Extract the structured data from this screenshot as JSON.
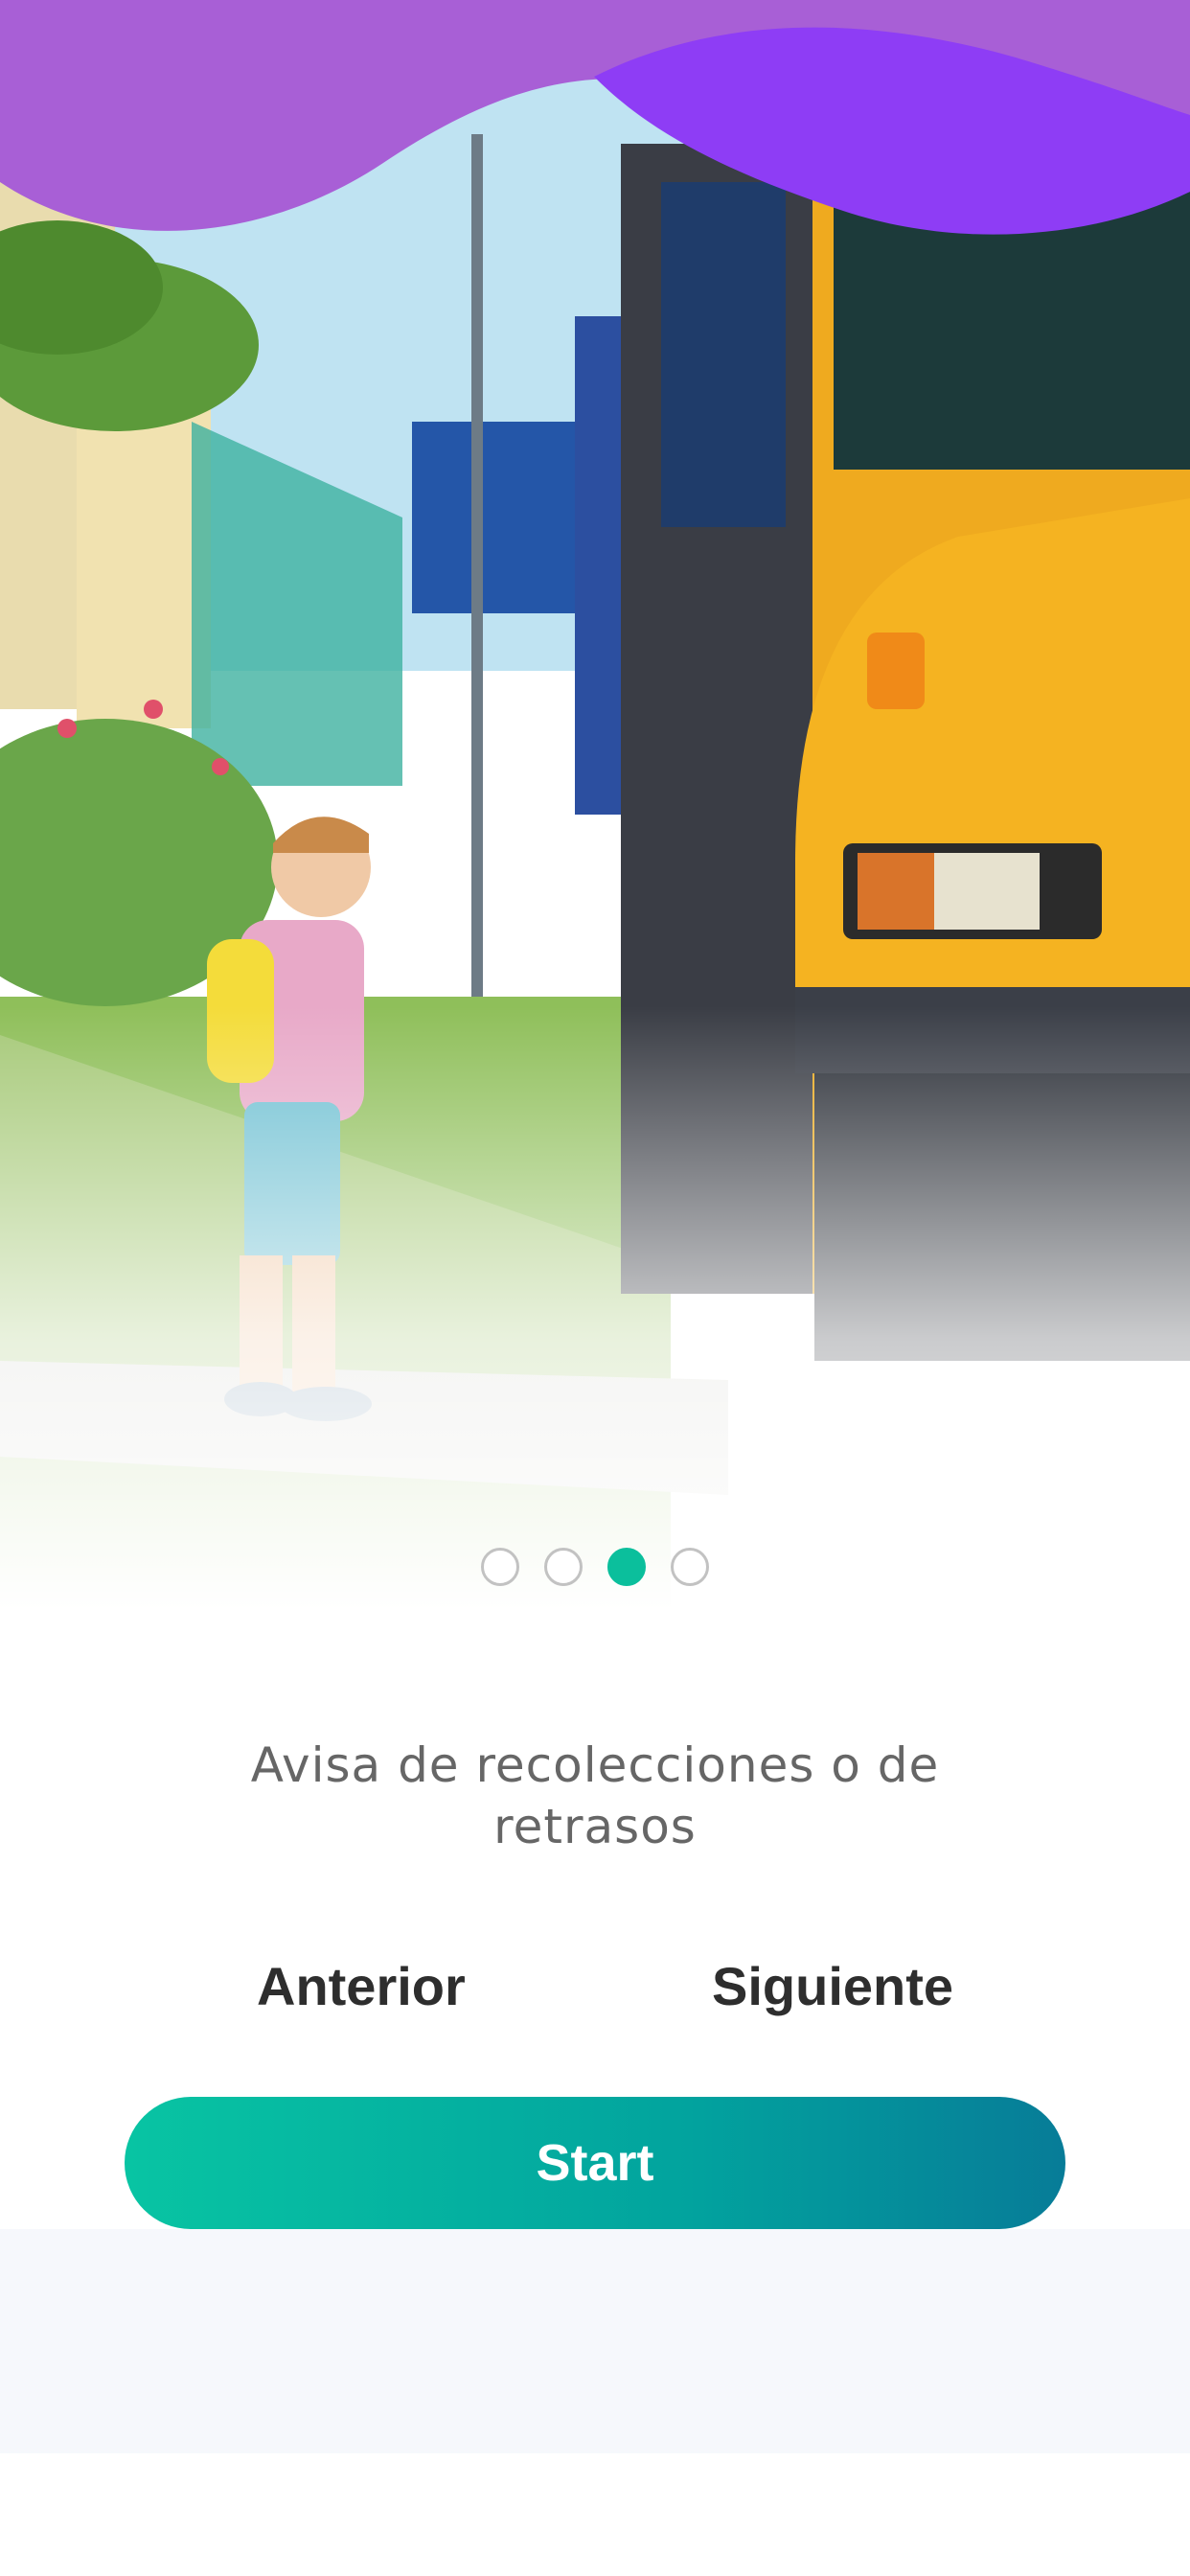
{
  "onboarding": {
    "caption": "Avisa de recolecciones o de retrasos",
    "pager": {
      "total": 4,
      "active_index": 2
    },
    "prev_label": "Anterior",
    "next_label": "Siguiente",
    "start_label": "Start"
  },
  "colors": {
    "wave_purple": "#9b4de0",
    "wave_violet": "#8a3bf0",
    "accent_teal": "#0bbf9c",
    "button_gradient_start": "#08c4a3",
    "button_gradient_end": "#077c98",
    "caption_text": "#666666",
    "nav_text": "#2e2e2e"
  },
  "hero_image": {
    "icon": "school-bus-photo",
    "subject": "child-with-backpack-boarding-school-bus"
  }
}
